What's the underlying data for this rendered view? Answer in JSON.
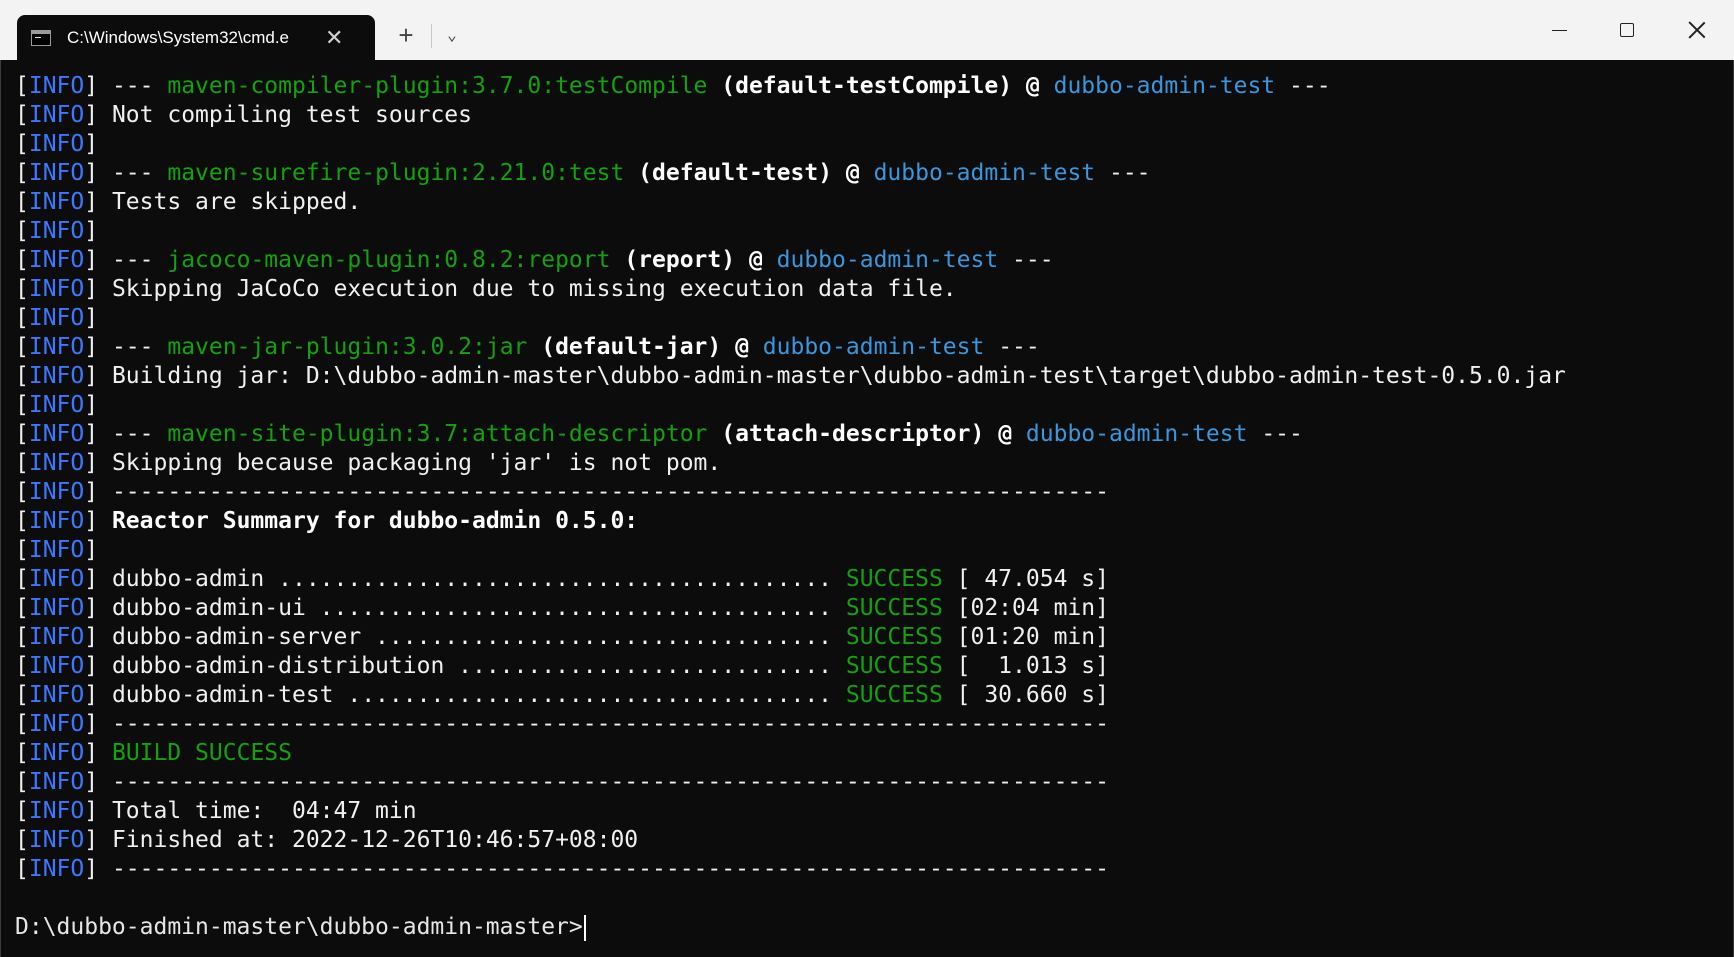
{
  "window": {
    "tab_title": "C:\\Windows\\System32\\cmd.e",
    "tab_close": "✕",
    "new_tab": "+",
    "dropdown": "⌄"
  },
  "console": {
    "lines": [
      {
        "tag": "INFO",
        "text": " --- ",
        "plugin": "maven-compiler-plugin:3.7.0:testCompile",
        "exec": " (default-testCompile) @ ",
        "project": "dubbo-admin-test",
        "tail": " ---"
      },
      {
        "tag": "INFO",
        "text": " Not compiling test sources"
      },
      {
        "tag": "INFO",
        "text": ""
      },
      {
        "tag": "INFO",
        "text": " --- ",
        "plugin": "maven-surefire-plugin:2.21.0:test",
        "exec": " (default-test) @ ",
        "project": "dubbo-admin-test",
        "tail": " ---"
      },
      {
        "tag": "INFO",
        "text": " Tests are skipped."
      },
      {
        "tag": "INFO",
        "text": ""
      },
      {
        "tag": "INFO",
        "text": " --- ",
        "plugin": "jacoco-maven-plugin:0.8.2:report",
        "exec": " (report) @ ",
        "project": "dubbo-admin-test",
        "tail": " ---"
      },
      {
        "tag": "INFO",
        "text": " Skipping JaCoCo execution due to missing execution data file."
      },
      {
        "tag": "INFO",
        "text": ""
      },
      {
        "tag": "INFO",
        "text": " --- ",
        "plugin": "maven-jar-plugin:3.0.2:jar",
        "exec": " (default-jar) @ ",
        "project": "dubbo-admin-test",
        "tail": " ---"
      },
      {
        "tag": "INFO",
        "text": " Building jar: D:\\dubbo-admin-master\\dubbo-admin-master\\dubbo-admin-test\\target\\dubbo-admin-test-0.5.0.jar"
      },
      {
        "tag": "INFO",
        "text": ""
      },
      {
        "tag": "INFO",
        "text": " --- ",
        "plugin": "maven-site-plugin:3.7:attach-descriptor",
        "exec": " (attach-descriptor) @ ",
        "project": "dubbo-admin-test",
        "tail": " ---"
      },
      {
        "tag": "INFO",
        "text": " Skipping because packaging 'jar' is not pom."
      },
      {
        "tag": "INFO",
        "text": " ------------------------------------------------------------------------"
      },
      {
        "tag": "INFO",
        "bold": " Reactor Summary for dubbo-admin 0.5.0:"
      },
      {
        "tag": "INFO",
        "text": ""
      },
      {
        "tag": "INFO",
        "text": " dubbo-admin ........................................ ",
        "status": "SUCCESS",
        "time": " [ 47.054 s]"
      },
      {
        "tag": "INFO",
        "text": " dubbo-admin-ui ..................................... ",
        "status": "SUCCESS",
        "time": " [02:04 min]"
      },
      {
        "tag": "INFO",
        "text": " dubbo-admin-server ................................. ",
        "status": "SUCCESS",
        "time": " [01:20 min]"
      },
      {
        "tag": "INFO",
        "text": " dubbo-admin-distribution ........................... ",
        "status": "SUCCESS",
        "time": " [  1.013 s]"
      },
      {
        "tag": "INFO",
        "text": " dubbo-admin-test ................................... ",
        "status": "SUCCESS",
        "time": " [ 30.660 s]"
      },
      {
        "tag": "INFO",
        "text": " ------------------------------------------------------------------------"
      },
      {
        "tag": "INFO",
        "text": " ",
        "status": "BUILD SUCCESS"
      },
      {
        "tag": "INFO",
        "text": " ------------------------------------------------------------------------"
      },
      {
        "tag": "INFO",
        "text": " Total time:  04:47 min"
      },
      {
        "tag": "INFO",
        "text": " Finished at: 2022-12-26T10:46:57+08:00"
      },
      {
        "tag": "INFO",
        "text": " ------------------------------------------------------------------------"
      }
    ],
    "prompt": "D:\\dubbo-admin-master\\dubbo-admin-master>"
  },
  "colors": {
    "background": "#0c0c0c",
    "info_tag": "#3b78ff",
    "plugin_green": "#13a10e",
    "project_blue": "#3a96dd",
    "titlebar": "#f3f3f3"
  },
  "icons": [
    "terminal-icon",
    "close-icon",
    "plus-icon",
    "chevron-down-icon",
    "minimize-icon",
    "maximize-icon",
    "window-close-icon"
  ]
}
